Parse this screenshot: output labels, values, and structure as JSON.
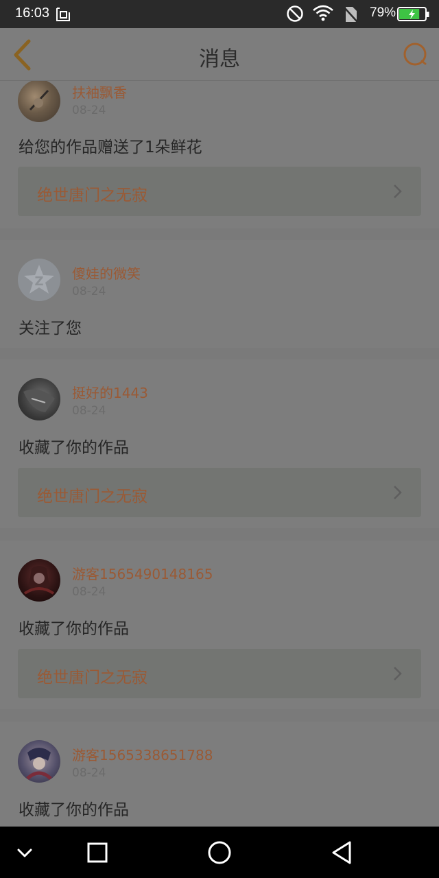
{
  "status_bar": {
    "time": "16:03",
    "battery_percent": "79%",
    "battery_level": 0.79,
    "icons": [
      "image-notification-icon",
      "do-not-disturb-icon",
      "wifi-icon",
      "no-sim-icon",
      "battery-charging-icon"
    ]
  },
  "header": {
    "title": "消息",
    "back_icon": "chevron-left-icon",
    "search_icon": "search-icon",
    "accent_color": "#9a5a35"
  },
  "messages": [
    {
      "username": "扶袖飘香",
      "date": "08-24",
      "action": "给您的作品赠送了1朵鲜花",
      "work": "绝世唐门之无寂"
    },
    {
      "username": "傻娃的微笑",
      "date": "08-24",
      "action": "关注了您",
      "work": null
    },
    {
      "username": "挺好的1443",
      "date": "08-24",
      "action": "收藏了你的作品",
      "work": "绝世唐门之无寂"
    },
    {
      "username": "游客1565490148165",
      "date": "08-24",
      "action": "收藏了你的作品",
      "work": "绝世唐门之无寂"
    },
    {
      "username": "游客1565338651788",
      "date": "08-24",
      "action": "收藏了你的作品",
      "work": null
    }
  ],
  "nav_bar": {
    "icons": [
      "collapse-icon",
      "recent-apps-icon",
      "home-icon",
      "back-icon"
    ]
  }
}
